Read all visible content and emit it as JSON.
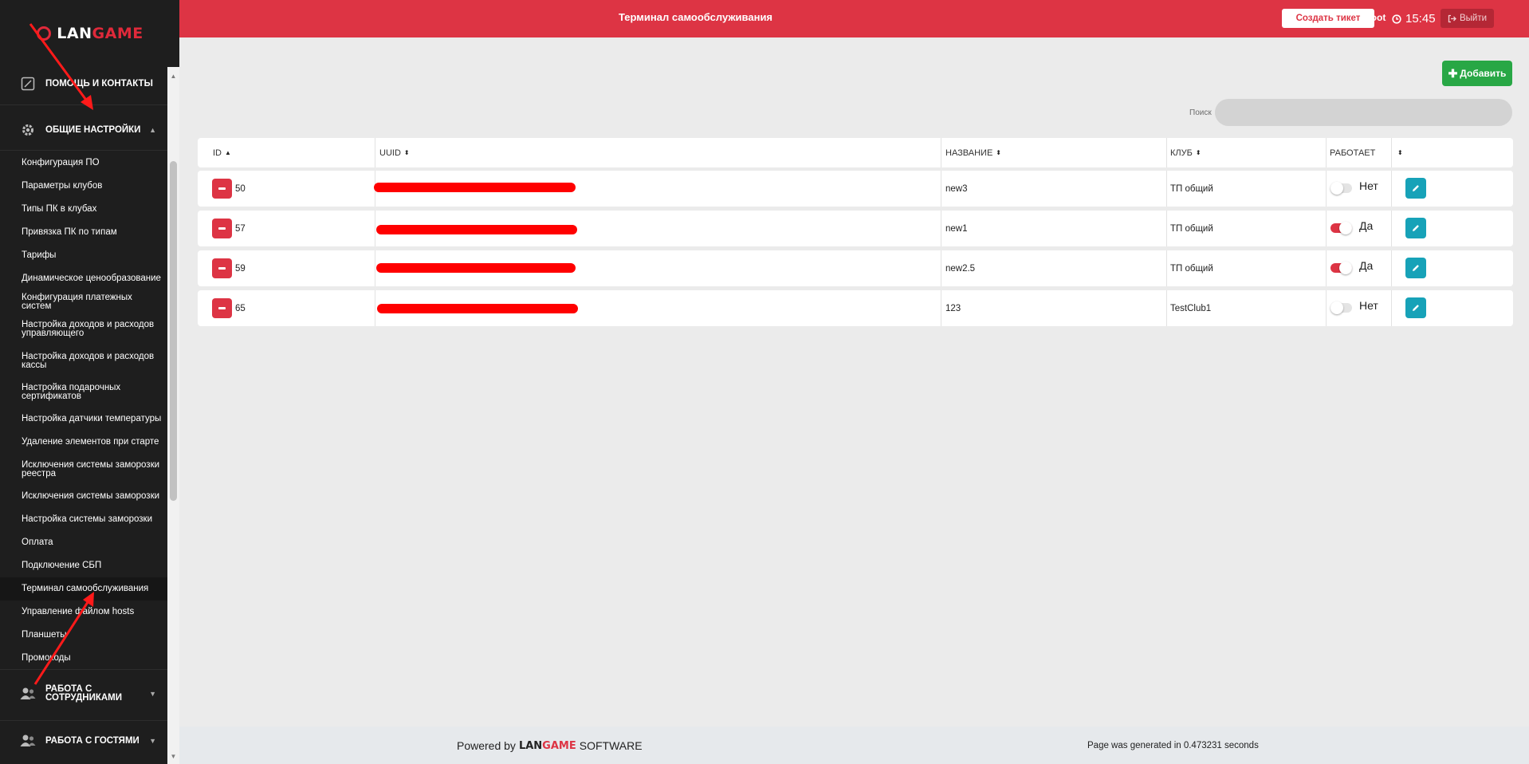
{
  "brand": {
    "lan": "LAN",
    "game": "GAME"
  },
  "sidebar": {
    "help_label": "ПОМОЩЬ И КОНТАКТЫ",
    "general_settings_label": "ОБЩИЕ НАСТРОЙКИ",
    "items": [
      {
        "label": "Конфигурация ПО"
      },
      {
        "label": "Параметры клубов"
      },
      {
        "label": "Типы ПК в клубах"
      },
      {
        "label": "Привязка ПК по типам"
      },
      {
        "label": "Тарифы"
      },
      {
        "label": "Динамическое ценообразование"
      },
      {
        "label": "Конфигурация платежных систем"
      },
      {
        "label": "Настройка доходов и расходов управляющего"
      },
      {
        "label": "Настройка доходов и расходов кассы"
      },
      {
        "label": "Настройка подарочных сертификатов"
      },
      {
        "label": "Настройка датчики температуры"
      },
      {
        "label": "Удаление элементов при старте"
      },
      {
        "label": "Исключения системы заморозки реестра"
      },
      {
        "label": "Исключения системы заморозки"
      },
      {
        "label": "Настройка системы заморозки"
      },
      {
        "label": "Оплата"
      },
      {
        "label": "Подключение СБП"
      },
      {
        "label": "Терминал самообслуживания"
      },
      {
        "label": "Управление файлом hosts"
      },
      {
        "label": "Планшеты"
      },
      {
        "label": "Промокоды"
      }
    ],
    "staff_label": "РАБОТА С СОТРУДНИКАМИ",
    "guests_label": "РАБОТА С ГОСТЯМИ"
  },
  "header": {
    "title": "Терминал самообслуживания",
    "ticket_label": "Создать тикет",
    "user": "Root",
    "time": "15:45",
    "logout_label": "Выйти"
  },
  "toolbar": {
    "add_label": "Добавить",
    "search_label": "Поиск",
    "search_value": ""
  },
  "table": {
    "columns": [
      "ID",
      "UUID",
      "НАЗВАНИЕ",
      "КЛУБ",
      "РАБОТАЕТ"
    ],
    "rows": [
      {
        "id": "50",
        "name": "new3",
        "club": "ТП общий",
        "working": false,
        "working_label": "Нет"
      },
      {
        "id": "57",
        "name": "new1",
        "club": "ТП общий",
        "working": true,
        "working_label": "Да"
      },
      {
        "id": "59",
        "name": "new2.5",
        "club": "ТП общий",
        "working": true,
        "working_label": "Да"
      },
      {
        "id": "65",
        "name": "123",
        "club": "TestClub1",
        "working": false,
        "working_label": "Нет"
      }
    ]
  },
  "footer": {
    "powered_by": "Powered by",
    "brand_lan": "LAN",
    "brand_game": "GAME",
    "software": "SOFTWARE",
    "generated": "Page was generated in 0.473231 seconds"
  },
  "colors": {
    "accent_red": "#dd3444",
    "add_green": "#28a745",
    "edit_teal": "#17a2b8",
    "sidebar_bg": "#1e1e1e"
  }
}
